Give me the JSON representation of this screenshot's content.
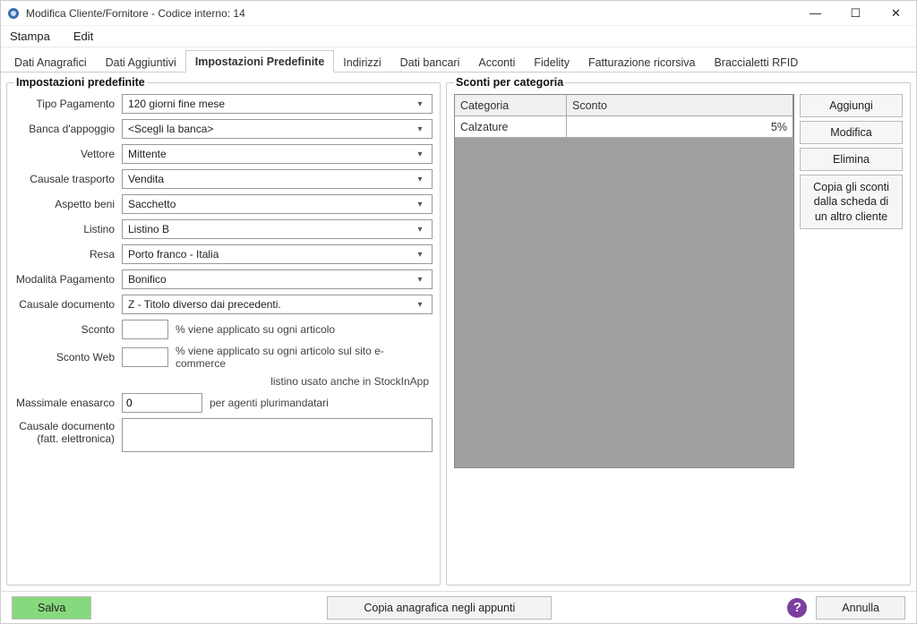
{
  "window": {
    "title": "Modifica Cliente/Fornitore - Codice interno: 14",
    "minimize_glyph": "—",
    "maximize_glyph": "☐",
    "close_glyph": "✕"
  },
  "menu": {
    "stampa": "Stampa",
    "edit": "Edit"
  },
  "tabs": {
    "dati_anagrafici": "Dati Anagrafici",
    "dati_aggiuntivi": "Dati Aggiuntivi",
    "impostazioni_predefinite": "Impostazioni Predefinite",
    "indirizzi": "Indirizzi",
    "dati_bancari": "Dati bancari",
    "acconti": "Acconti",
    "fidelity": "Fidelity",
    "fatturazione_ricorsiva": "Fatturazione ricorsiva",
    "braccialetti_rfid": "Braccialetti RFID"
  },
  "groupbox": {
    "left_title": "Impostazioni predefinite",
    "right_title": "Sconti per categoria"
  },
  "labels": {
    "tipo_pagamento": "Tipo Pagamento",
    "banca_appoggio": "Banca d'appoggio",
    "vettore": "Vettore",
    "causale_trasporto": "Causale trasporto",
    "aspetto_beni": "Aspetto beni",
    "listino": "Listino",
    "resa": "Resa",
    "modalita_pagamento": "Modalità Pagamento",
    "causale_documento": "Causale documento",
    "sconto": "Sconto",
    "sconto_web": "Sconto Web",
    "massimale_enasarco": "Massimale enasarco",
    "causale_doc_fe_line1": "Causale documento",
    "causale_doc_fe_line2": "(fatt. elettronica)"
  },
  "values": {
    "tipo_pagamento": "120 giorni fine mese",
    "banca_appoggio": "<Scegli la banca>",
    "vettore": "Mittente",
    "causale_trasporto": "Vendita",
    "aspetto_beni": "Sacchetto",
    "listino": "Listino B",
    "resa": "Porto franco - Italia",
    "modalita_pagamento": "Bonifico",
    "causale_documento": "Z - Titolo diverso dai precedenti.",
    "sconto": "",
    "sconto_web": "",
    "massimale_enasarco": "0",
    "causale_doc_fe": ""
  },
  "hints": {
    "sconto": "% viene applicato su ogni articolo",
    "sconto_web": "% viene applicato su ogni articolo sul sito e-commerce",
    "listino_stockinapp": "listino usato anche in StockInApp",
    "massimale": "per agenti plurimandatari"
  },
  "grid": {
    "col_categoria": "Categoria",
    "col_sconto": "Sconto",
    "rows": [
      {
        "categoria": "Calzature",
        "sconto": "5%"
      }
    ]
  },
  "buttons": {
    "aggiungi": "Aggiungi",
    "modifica": "Modifica",
    "elimina": "Elimina",
    "copia_sconti": "Copia gli sconti\ndalla scheda di\nun altro cliente"
  },
  "footer": {
    "salva": "Salva",
    "copia_appunti": "Copia anagrafica negli appunti",
    "annulla": "Annulla",
    "help_glyph": "?"
  }
}
